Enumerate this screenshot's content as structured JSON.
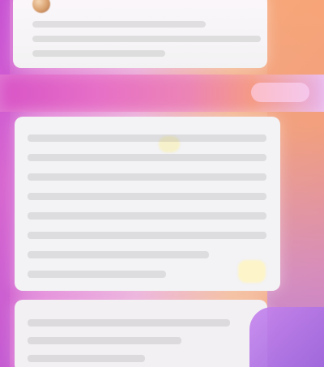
{
  "palette": {
    "left_accent": "#cf5fcf",
    "right_accent": "#f39b7a",
    "card_background": "#f3f2f4",
    "banner_start": "#d854c7",
    "banner_end": "#e8b2e8"
  },
  "icons": {
    "avatar": "avatar-icon"
  }
}
